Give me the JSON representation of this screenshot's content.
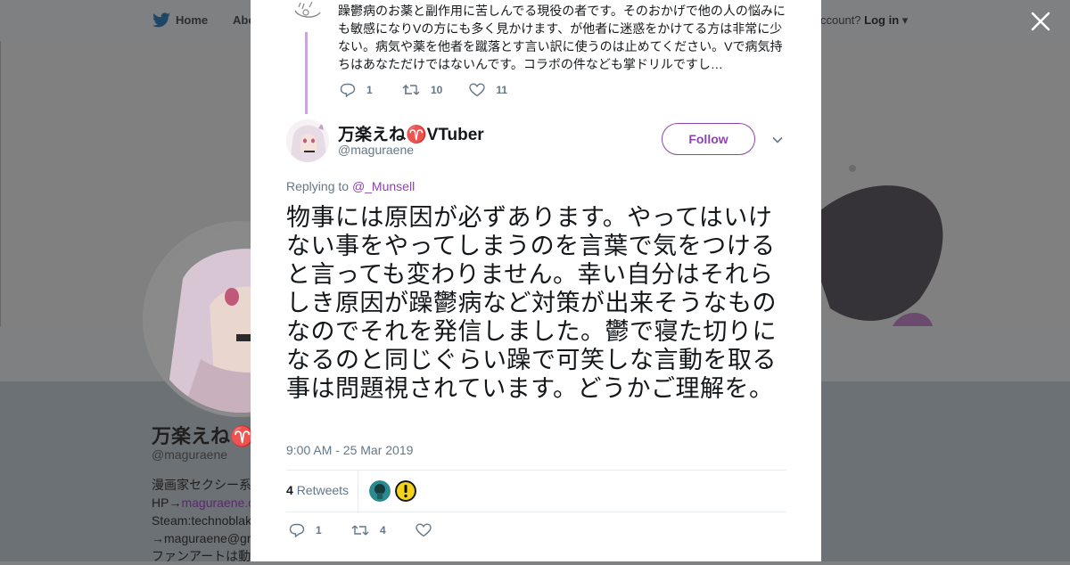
{
  "background": {
    "nav": {
      "home": "Home",
      "about": "Abo",
      "account_prompt": "ccount?",
      "login": "Log in"
    },
    "profile": {
      "name": "万楽えね♈",
      "handle": "@maguraene",
      "bio_lines": [
        "漫画家セクシー系",
        "HP→",
        "Steam:technoblak",
        "→maguraene@gr",
        "ファンアートは動"
      ],
      "bio_link": "maguraene.c"
    }
  },
  "prev_tweet": {
    "text": "躁鬱病のお薬と副作用に苦しんでる現役の者です。そのおかげで他の人の悩みにも敏感になりVの方にも多く見かけます、が他者に迷惑をかけてる方は非常に少ない。病気や薬を他者を蹴落とす言い訳に使うのは止めてください。Vで病気持ちはあなただけではないんです。コラボの件なども掌ドリルですし…",
    "replies": "1",
    "retweets": "10",
    "likes": "11"
  },
  "tweet": {
    "author_name": "万楽えね♈VTuber",
    "author_handle": "@maguraene",
    "follow_label": "Follow",
    "replying_prefix": "Replying to",
    "replying_to": "@_Munsell",
    "text": "物事には原因が必ずあります。やってはいけない事をやってしまうのを言葉で気をつけると言っても変わりません。幸い自分はそれらしき原因が躁鬱病など対策が出来そうなものなのでそれを発信しました。鬱で寝た切りになるのと同じぐらい躁で可笑しな言動を取る事は問題視されています。どうかご理解を。",
    "timestamp": "9:00 AM - 25 Mar 2019",
    "retweet_count": "4",
    "retweet_label": "Retweets",
    "replies": "1",
    "retweets": "4"
  },
  "colors": {
    "accent": "#8e44ad",
    "muted": "#657786",
    "thread": "#c9a5d9"
  }
}
